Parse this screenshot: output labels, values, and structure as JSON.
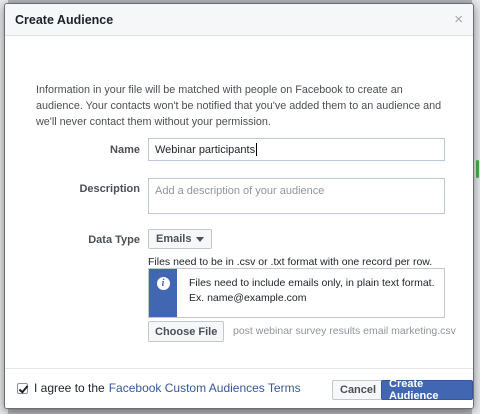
{
  "dialog": {
    "title": "Create Audience",
    "close_glyph": "×",
    "intro": "Information in your file will be matched with people on Facebook to create an audience. Your contacts won't be notified that you've added them to an audience and we'll never contact them without your permission."
  },
  "form": {
    "name_label": "Name",
    "name_value": "Webinar participants",
    "description_label": "Description",
    "description_placeholder": "Add a description of your audience",
    "data_type_label": "Data Type",
    "data_type_selected": "Emails",
    "files_note": "Files need to be in .csv or .txt format with one record per row.",
    "info_line1": "Files need to include emails only, in plain text format.",
    "info_line2": "Ex. name@example.com",
    "choose_file_label": "Choose File",
    "file_name": "post webinar survey results email marketing.csv"
  },
  "footer": {
    "agree_checked": true,
    "agree_text": "I agree to the",
    "terms_link": "Facebook Custom Audiences Terms",
    "cancel_label": "Cancel",
    "create_label": "Create Audience"
  },
  "colors": {
    "primary": "#4267b2",
    "link": "#365899"
  },
  "icons": {
    "close": "close-icon",
    "info": "info-icon",
    "dropdown": "chevron-down-icon",
    "checkbox": "checkbox-checked"
  }
}
